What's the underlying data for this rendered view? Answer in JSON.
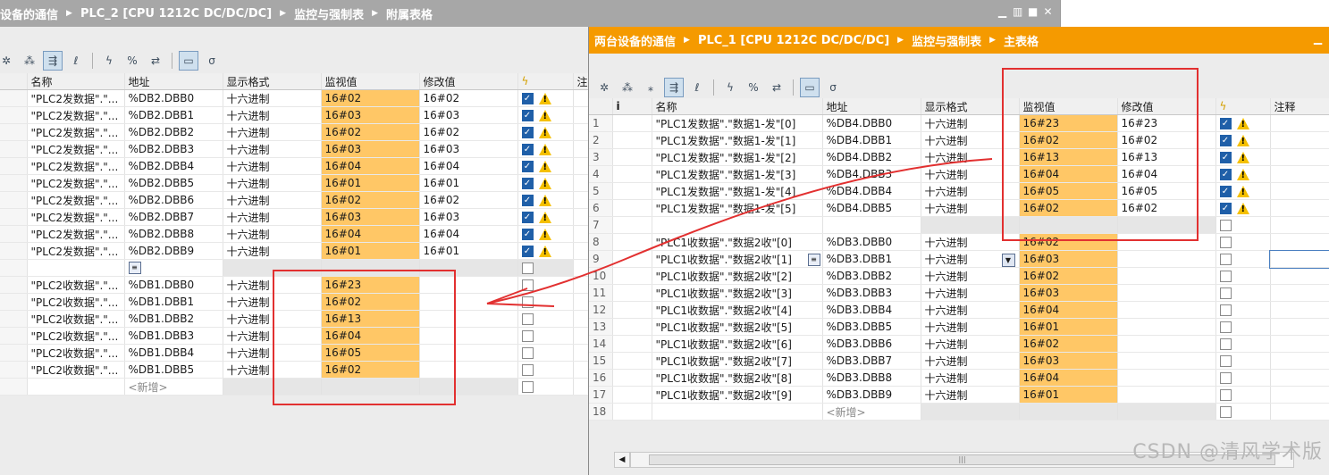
{
  "left_window": {
    "breadcrumb": [
      "设备的通信",
      "PLC_2 [CPU 1212C DC/DC/DC]",
      "监控与强制表",
      "附属表格"
    ],
    "columns": [
      "名称",
      "地址",
      "显示格式",
      "监视值",
      "修改值",
      "",
      "注"
    ],
    "rows": [
      {
        "name": "\"PLC2发数据\".\"...",
        "addr": "%DB2.DBB0",
        "fmt": "十六进制",
        "mon": "16#02",
        "mod": "16#02",
        "checked": true,
        "warn": true
      },
      {
        "name": "\"PLC2发数据\".\"...",
        "addr": "%DB2.DBB1",
        "fmt": "十六进制",
        "mon": "16#03",
        "mod": "16#03",
        "checked": true,
        "warn": true
      },
      {
        "name": "\"PLC2发数据\".\"...",
        "addr": "%DB2.DBB2",
        "fmt": "十六进制",
        "mon": "16#02",
        "mod": "16#02",
        "checked": true,
        "warn": true
      },
      {
        "name": "\"PLC2发数据\".\"...",
        "addr": "%DB2.DBB3",
        "fmt": "十六进制",
        "mon": "16#03",
        "mod": "16#03",
        "checked": true,
        "warn": true
      },
      {
        "name": "\"PLC2发数据\".\"...",
        "addr": "%DB2.DBB4",
        "fmt": "十六进制",
        "mon": "16#04",
        "mod": "16#04",
        "checked": true,
        "warn": true
      },
      {
        "name": "\"PLC2发数据\".\"...",
        "addr": "%DB2.DBB5",
        "fmt": "十六进制",
        "mon": "16#01",
        "mod": "16#01",
        "checked": true,
        "warn": true
      },
      {
        "name": "\"PLC2发数据\".\"...",
        "addr": "%DB2.DBB6",
        "fmt": "十六进制",
        "mon": "16#02",
        "mod": "16#02",
        "checked": true,
        "warn": true
      },
      {
        "name": "\"PLC2发数据\".\"...",
        "addr": "%DB2.DBB7",
        "fmt": "十六进制",
        "mon": "16#03",
        "mod": "16#03",
        "checked": true,
        "warn": true
      },
      {
        "name": "\"PLC2发数据\".\"...",
        "addr": "%DB2.DBB8",
        "fmt": "十六进制",
        "mon": "16#04",
        "mod": "16#04",
        "checked": true,
        "warn": true
      },
      {
        "name": "\"PLC2发数据\".\"...",
        "addr": "%DB2.DBB9",
        "fmt": "十六进制",
        "mon": "16#01",
        "mod": "16#01",
        "checked": true,
        "warn": true
      },
      {
        "blank": true
      },
      {
        "name": "\"PLC2收数据\".\"...",
        "addr": "%DB1.DBB0",
        "fmt": "十六进制",
        "mon": "16#23",
        "mod": "",
        "checked": false,
        "warn": false
      },
      {
        "name": "\"PLC2收数据\".\"...",
        "addr": "%DB1.DBB1",
        "fmt": "十六进制",
        "mon": "16#02",
        "mod": "",
        "checked": false,
        "warn": false
      },
      {
        "name": "\"PLC2收数据\".\"...",
        "addr": "%DB1.DBB2",
        "fmt": "十六进制",
        "mon": "16#13",
        "mod": "",
        "checked": false,
        "warn": false
      },
      {
        "name": "\"PLC2收数据\".\"...",
        "addr": "%DB1.DBB3",
        "fmt": "十六进制",
        "mon": "16#04",
        "mod": "",
        "checked": false,
        "warn": false
      },
      {
        "name": "\"PLC2收数据\".\"...",
        "addr": "%DB1.DBB4",
        "fmt": "十六进制",
        "mon": "16#05",
        "mod": "",
        "checked": false,
        "warn": false
      },
      {
        "name": "\"PLC2收数据\".\"...",
        "addr": "%DB1.DBB5",
        "fmt": "十六进制",
        "mon": "16#02",
        "mod": "",
        "checked": false,
        "warn": false
      }
    ],
    "add_row_label": "<新增>"
  },
  "right_window": {
    "breadcrumb": [
      "两台设备的通信",
      "PLC_1 [CPU 1212C DC/DC/DC]",
      "监控与强制表",
      "主表格"
    ],
    "columns": [
      "",
      "i",
      "名称",
      "地址",
      "显示格式",
      "监视值",
      "修改值",
      "",
      "注释"
    ],
    "rows": [
      {
        "idx": "1",
        "name": "\"PLC1发数据\".\"数据1-发\"[0]",
        "addr": "%DB4.DBB0",
        "fmt": "十六进制",
        "mon": "16#23",
        "mod": "16#23",
        "checked": true,
        "warn": true
      },
      {
        "idx": "2",
        "name": "\"PLC1发数据\".\"数据1-发\"[1]",
        "addr": "%DB4.DBB1",
        "fmt": "十六进制",
        "mon": "16#02",
        "mod": "16#02",
        "checked": true,
        "warn": true
      },
      {
        "idx": "3",
        "name": "\"PLC1发数据\".\"数据1-发\"[2]",
        "addr": "%DB4.DBB2",
        "fmt": "十六进制",
        "mon": "16#13",
        "mod": "16#13",
        "checked": true,
        "warn": true
      },
      {
        "idx": "4",
        "name": "\"PLC1发数据\".\"数据1-发\"[3]",
        "addr": "%DB4.DBB3",
        "fmt": "十六进制",
        "mon": "16#04",
        "mod": "16#04",
        "checked": true,
        "warn": true
      },
      {
        "idx": "5",
        "name": "\"PLC1发数据\".\"数据1-发\"[4]",
        "addr": "%DB4.DBB4",
        "fmt": "十六进制",
        "mon": "16#05",
        "mod": "16#05",
        "checked": true,
        "warn": true
      },
      {
        "idx": "6",
        "name": "\"PLC1发数据\".\"数据1-发\"[5]",
        "addr": "%DB4.DBB5",
        "fmt": "十六进制",
        "mon": "16#02",
        "mod": "16#02",
        "checked": true,
        "warn": true
      },
      {
        "idx": "7",
        "blank": true
      },
      {
        "idx": "8",
        "name": "\"PLC1收数据\".\"数据2收\"[0]",
        "addr": "%DB3.DBB0",
        "fmt": "十六进制",
        "mon": "16#02",
        "mod": "",
        "checked": false,
        "warn": false
      },
      {
        "idx": "9",
        "name": "\"PLC1收数据\".\"数据2收\"[1]",
        "addr": "%DB3.DBB1",
        "fmt": "十六进制",
        "mon": "16#03",
        "mod": "",
        "checked": false,
        "warn": false
      },
      {
        "idx": "10",
        "name": "\"PLC1收数据\".\"数据2收\"[2]",
        "addr": "%DB3.DBB2",
        "fmt": "十六进制",
        "mon": "16#02",
        "mod": "",
        "checked": false,
        "warn": false
      },
      {
        "idx": "11",
        "name": "\"PLC1收数据\".\"数据2收\"[3]",
        "addr": "%DB3.DBB3",
        "fmt": "十六进制",
        "mon": "16#03",
        "mod": "",
        "checked": false,
        "warn": false
      },
      {
        "idx": "12",
        "name": "\"PLC1收数据\".\"数据2收\"[4]",
        "addr": "%DB3.DBB4",
        "fmt": "十六进制",
        "mon": "16#04",
        "mod": "",
        "checked": false,
        "warn": false
      },
      {
        "idx": "13",
        "name": "\"PLC1收数据\".\"数据2收\"[5]",
        "addr": "%DB3.DBB5",
        "fmt": "十六进制",
        "mon": "16#01",
        "mod": "",
        "checked": false,
        "warn": false
      },
      {
        "idx": "14",
        "name": "\"PLC1收数据\".\"数据2收\"[6]",
        "addr": "%DB3.DBB6",
        "fmt": "十六进制",
        "mon": "16#02",
        "mod": "",
        "checked": false,
        "warn": false
      },
      {
        "idx": "15",
        "name": "\"PLC1收数据\".\"数据2收\"[7]",
        "addr": "%DB3.DBB7",
        "fmt": "十六进制",
        "mon": "16#03",
        "mod": "",
        "checked": false,
        "warn": false
      },
      {
        "idx": "16",
        "name": "\"PLC1收数据\".\"数据2收\"[8]",
        "addr": "%DB3.DBB8",
        "fmt": "十六进制",
        "mon": "16#04",
        "mod": "",
        "checked": false,
        "warn": false
      },
      {
        "idx": "17",
        "name": "\"PLC1收数据\".\"数据2收\"[9]",
        "addr": "%DB3.DBB9",
        "fmt": "十六进制",
        "mon": "16#01",
        "mod": "",
        "checked": false,
        "warn": false
      },
      {
        "idx": "18",
        "add": true
      }
    ],
    "add_row_label": "<新增>"
  },
  "watermark": "CSDN @清风学术版",
  "colors": {
    "monitor_cell": "#ffc766",
    "left_title": "#a7a7a7",
    "right_title": "#f59a00",
    "annotation": "#e23030"
  },
  "icons": [
    "insert-row-icon",
    "add-row-icon",
    "refresh-icon",
    "monitor-all-icon",
    "monitor-once-icon",
    "modify-now-icon",
    "modify-trigger-icon",
    "force-icon",
    "show-columns-icon",
    "advanced-settings-icon"
  ]
}
